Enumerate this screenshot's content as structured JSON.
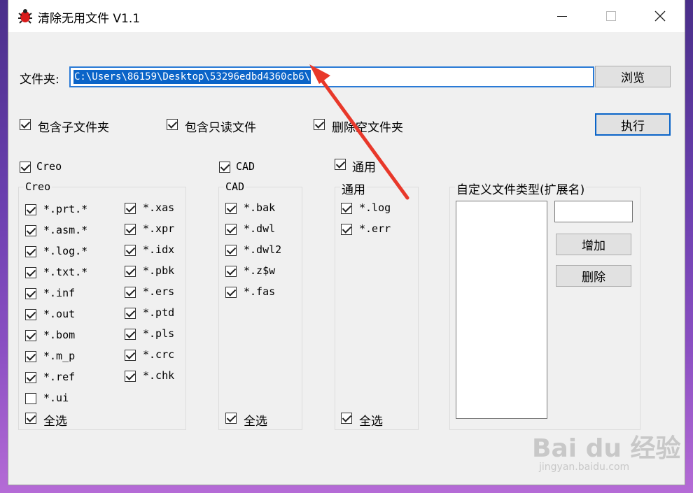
{
  "window": {
    "title": "清除无用文件  V1.1",
    "controls": {
      "minimize": "minimize",
      "maximize": "maximize",
      "close": "×"
    }
  },
  "folder": {
    "label": "文件夹:",
    "path": "C:\\Users\\86159\\Desktop\\53296edbd4360cb6\\",
    "browse_label": "浏览"
  },
  "options": [
    {
      "label": "包含子文件夹",
      "checked": true
    },
    {
      "label": "包含只读文件",
      "checked": true
    },
    {
      "label": "删除空文件夹",
      "checked": true
    }
  ],
  "execute_label": "执行",
  "categories": {
    "creo": {
      "label": "Creo",
      "checked": true
    },
    "cad": {
      "label": "CAD",
      "checked": true
    },
    "general": {
      "label": "通用",
      "checked": true
    }
  },
  "creo_group": {
    "caption": "Creo",
    "col1": [
      {
        "label": "*.prt.*",
        "checked": true
      },
      {
        "label": "*.asm.*",
        "checked": true
      },
      {
        "label": "*.log.*",
        "checked": true
      },
      {
        "label": "*.txt.*",
        "checked": true
      },
      {
        "label": "*.inf",
        "checked": true
      },
      {
        "label": "*.out",
        "checked": true
      },
      {
        "label": "*.bom",
        "checked": true
      },
      {
        "label": "*.m_p",
        "checked": true
      },
      {
        "label": "*.ref",
        "checked": true
      },
      {
        "label": "*.ui",
        "checked": false
      }
    ],
    "col2": [
      {
        "label": "*.xas",
        "checked": true
      },
      {
        "label": "*.xpr",
        "checked": true
      },
      {
        "label": "*.idx",
        "checked": true
      },
      {
        "label": "*.pbk",
        "checked": true
      },
      {
        "label": "*.ers",
        "checked": true
      },
      {
        "label": "*.ptd",
        "checked": true
      },
      {
        "label": "*.pls",
        "checked": true
      },
      {
        "label": "*.crc",
        "checked": true
      },
      {
        "label": "*.chk",
        "checked": true
      }
    ],
    "select_all": "全选"
  },
  "cad_group": {
    "caption": "CAD",
    "items": [
      {
        "label": "*.bak",
        "checked": true
      },
      {
        "label": "*.dwl",
        "checked": true
      },
      {
        "label": "*.dwl2",
        "checked": true
      },
      {
        "label": "*.z$w",
        "checked": true
      },
      {
        "label": "*.fas",
        "checked": true
      }
    ],
    "select_all": "全选"
  },
  "general_group": {
    "caption": "通用",
    "items": [
      {
        "label": "*.log",
        "checked": true
      },
      {
        "label": "*.err",
        "checked": true
      }
    ],
    "select_all": "全选"
  },
  "custom_group": {
    "caption": "自定义文件类型(扩展名)",
    "input_value": "",
    "add_label": "增加",
    "delete_label": "删除"
  },
  "watermark": {
    "brand": "Bai du 经验",
    "url": "jingyan.baidu.com"
  },
  "colors": {
    "accent": "#0a64c8",
    "arrow": "#e8382a",
    "window_bg": "#f0f0f0"
  }
}
